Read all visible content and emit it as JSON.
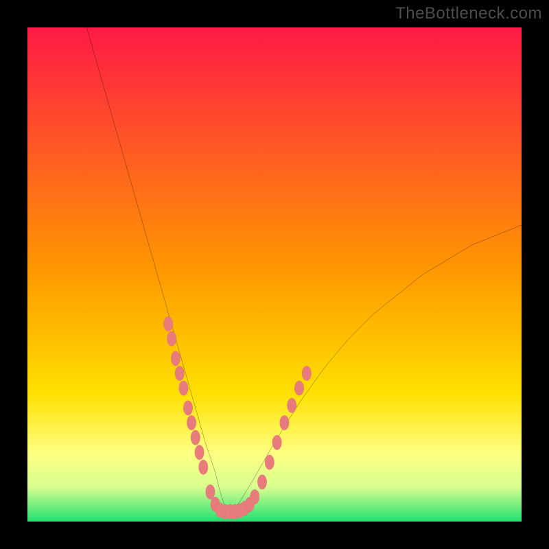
{
  "watermark": "TheBottleneck.com",
  "colors": {
    "page_bg": "#000000",
    "grad_top": "#ff1a45",
    "grad_mid": "#ffe000",
    "grad_low": "#ffff80",
    "grad_bottom": "#20e070",
    "curve": "#000000",
    "marker_fill": "#e87b7b",
    "marker_stroke": "#c85a5a",
    "watermark": "#4d4d4d"
  },
  "chart_data": {
    "type": "line",
    "title": "",
    "xlabel": "",
    "ylabel": "",
    "xlim": [
      0,
      100
    ],
    "ylim": [
      0,
      100
    ],
    "grid": false,
    "legend": false,
    "gradient_bands": [
      {
        "stop": 0.0,
        "color": "#ff1a45"
      },
      {
        "stop": 0.5,
        "color": "#ff9a00"
      },
      {
        "stop": 0.74,
        "color": "#ffe000"
      },
      {
        "stop": 0.86,
        "color": "#ffff80"
      },
      {
        "stop": 0.93,
        "color": "#d8ff90"
      },
      {
        "stop": 1.0,
        "color": "#20e070"
      }
    ],
    "series": [
      {
        "name": "left-branch",
        "x": [
          12,
          14,
          16,
          18,
          20,
          22,
          24,
          26,
          28,
          30,
          32,
          34,
          36,
          38,
          39,
          40,
          41
        ],
        "y": [
          100,
          93,
          86,
          79,
          72,
          65,
          58,
          51,
          44,
          37,
          30,
          23,
          16,
          10,
          6,
          3,
          2
        ]
      },
      {
        "name": "right-branch",
        "x": [
          41,
          43,
          46,
          50,
          55,
          60,
          65,
          70,
          75,
          80,
          85,
          90,
          95,
          100
        ],
        "y": [
          2,
          4,
          9,
          16,
          24,
          31,
          37,
          42,
          46,
          50,
          53,
          56,
          58,
          60
        ]
      },
      {
        "name": "floor",
        "x": [
          38,
          45
        ],
        "y": [
          2,
          2
        ]
      }
    ],
    "markers": [
      {
        "x": 28.5,
        "y": 40
      },
      {
        "x": 29.2,
        "y": 37
      },
      {
        "x": 30.0,
        "y": 33
      },
      {
        "x": 30.8,
        "y": 30
      },
      {
        "x": 31.6,
        "y": 27
      },
      {
        "x": 32.5,
        "y": 23
      },
      {
        "x": 33.2,
        "y": 20
      },
      {
        "x": 34.0,
        "y": 17
      },
      {
        "x": 34.8,
        "y": 14
      },
      {
        "x": 35.6,
        "y": 11
      },
      {
        "x": 37.0,
        "y": 6
      },
      {
        "x": 38.0,
        "y": 3.5
      },
      {
        "x": 39.0,
        "y": 2.3
      },
      {
        "x": 40.0,
        "y": 2.0
      },
      {
        "x": 41.0,
        "y": 2.0
      },
      {
        "x": 42.0,
        "y": 2.0
      },
      {
        "x": 43.0,
        "y": 2.2
      },
      {
        "x": 44.0,
        "y": 2.7
      },
      {
        "x": 45.0,
        "y": 3.5
      },
      {
        "x": 46.0,
        "y": 5.0
      },
      {
        "x": 47.5,
        "y": 8.0
      },
      {
        "x": 49.0,
        "y": 12.0
      },
      {
        "x": 50.5,
        "y": 16.0
      },
      {
        "x": 52.0,
        "y": 20.0
      },
      {
        "x": 53.5,
        "y": 23.5
      },
      {
        "x": 55.0,
        "y": 27.0
      },
      {
        "x": 56.5,
        "y": 30.0
      }
    ]
  }
}
